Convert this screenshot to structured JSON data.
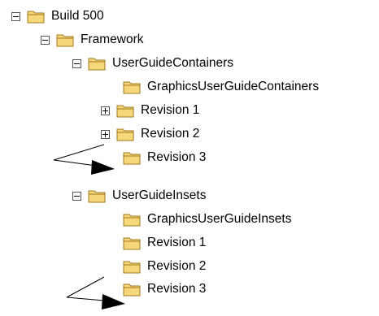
{
  "tree": {
    "nodes": [
      {
        "label": "Build 500",
        "toggle": "minus",
        "depth": 0
      },
      {
        "label": "Framework",
        "toggle": "minus",
        "depth": 1
      },
      {
        "label": "UserGuideContainers",
        "toggle": "minus",
        "depth": 2
      },
      {
        "label": "GraphicsUserGuideContainers",
        "toggle": "none",
        "depth": 3
      },
      {
        "label": "Revision 1",
        "toggle": "plus",
        "depth": 3
      },
      {
        "label": "Revision 2",
        "toggle": "plus",
        "depth": 3
      },
      {
        "label": "Revision 3",
        "toggle": "none",
        "depth": 3
      },
      {
        "label": "UserGuideInsets",
        "toggle": "minus",
        "depth": 2
      },
      {
        "label": "GraphicsUserGuideInsets",
        "toggle": "none",
        "depth": 3
      },
      {
        "label": "Revision 1",
        "toggle": "none",
        "depth": 3
      },
      {
        "label": "Revision 2",
        "toggle": "none",
        "depth": 3
      },
      {
        "label": "Revision 3",
        "toggle": "none",
        "depth": 3
      }
    ]
  },
  "colors": {
    "folder_fill": "#f6d77a",
    "folder_stroke": "#a07a1c",
    "folder_tab": "#f9e3a0",
    "arrow": "#000000"
  }
}
